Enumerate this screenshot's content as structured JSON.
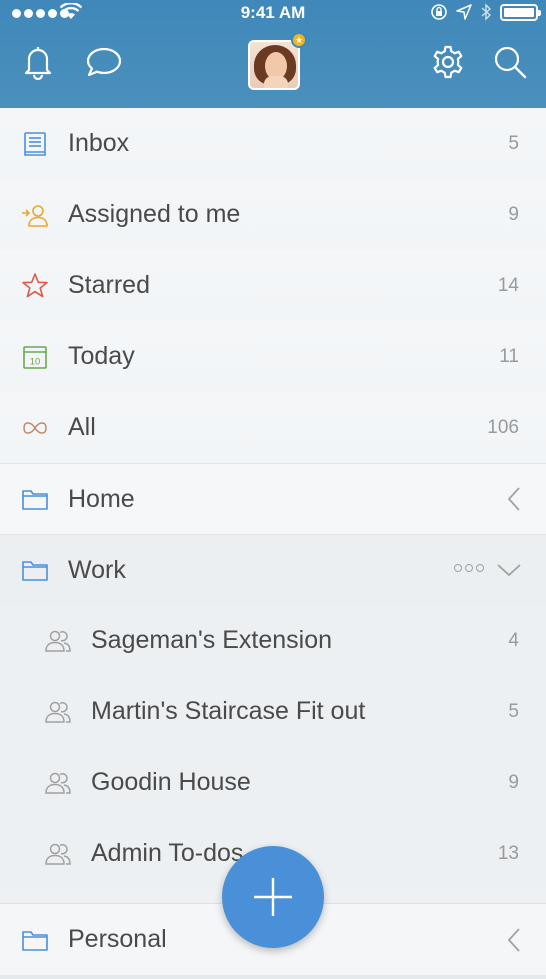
{
  "status_bar": {
    "time": "9:41 AM"
  },
  "header": {
    "icons": [
      "bell-icon",
      "chat-icon",
      "gear-icon",
      "search-icon"
    ],
    "avatar_badge": "★"
  },
  "smart_lists": [
    {
      "label": "Inbox",
      "count": "5",
      "icon": "inbox-icon",
      "color": "#4a90d9"
    },
    {
      "label": "Assigned to me",
      "count": "9",
      "icon": "assigned-icon",
      "color": "#e8a92b"
    },
    {
      "label": "Starred",
      "count": "14",
      "icon": "star-icon",
      "color": "#e05a4b"
    },
    {
      "label": "Today",
      "count": "11",
      "icon": "calendar-icon",
      "color": "#6aa84f",
      "calendar_day": "10"
    },
    {
      "label": "All",
      "count": "106",
      "icon": "infinity-icon",
      "color": "#c08a6a"
    }
  ],
  "folders": {
    "home": {
      "label": "Home"
    },
    "work": {
      "label": "Work",
      "lists": [
        {
          "label": "Sageman's Extension",
          "count": "4"
        },
        {
          "label": "Martin's Staircase Fit out",
          "count": "5"
        },
        {
          "label": "Goodin House",
          "count": "9"
        },
        {
          "label": "Admin To-dos",
          "count": "13"
        }
      ]
    },
    "personal": {
      "label": "Personal"
    }
  },
  "colors": {
    "header": "#3f88b9",
    "accent": "#4a90d9",
    "folder_icon": "#4a90d9"
  }
}
